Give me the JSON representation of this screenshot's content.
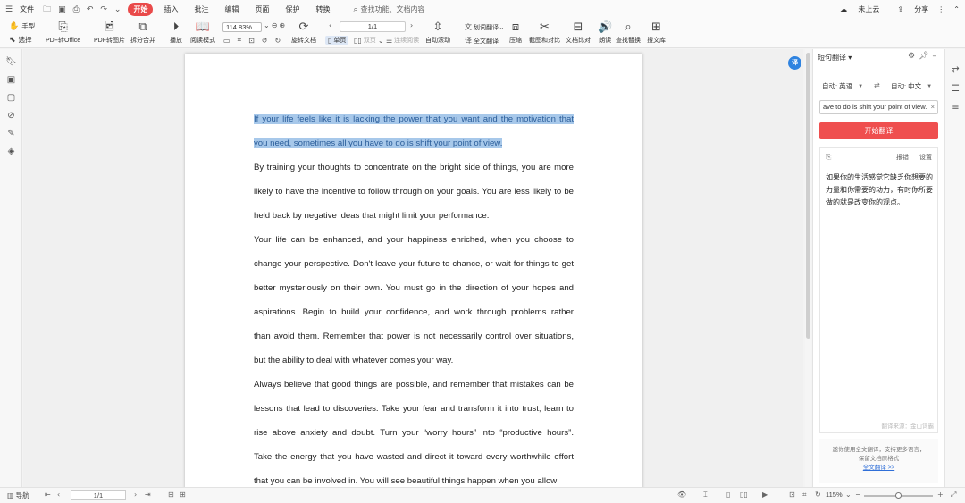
{
  "menubar": {
    "file": "文件",
    "tabs": [
      "开始",
      "插入",
      "批注",
      "编辑",
      "页面",
      "保护",
      "转换"
    ],
    "active_tab": "开始",
    "search": "查找功能、文档内容",
    "cloud": "未上云",
    "share": "分享"
  },
  "toolbar": {
    "hand": "手型",
    "select": "选择",
    "pdf_to_office": "PDF转Office",
    "pdf_to_image": "PDF转图片",
    "split_merge": "拆分合并",
    "play": "播放",
    "read_mode": "阅读模式",
    "zoom": "114.83%",
    "rotate_doc": "旋转文档",
    "single_page": "单页",
    "double_page": "双页",
    "continuous": "连续阅读",
    "page_indicator": "1/1",
    "auto_scroll": "自动滚动",
    "word_translate": "划词翻译",
    "full_translate": "全文翻译",
    "compress": "压缩",
    "screenshot_compare": "截图和对比",
    "doc_compare": "文档比对",
    "read_aloud": "朗读",
    "find_replace": "查找替换",
    "search_lib": "搜文库"
  },
  "document": {
    "paragraphs": [
      {
        "highlighted": true,
        "lines": [
          "If your life feels like it is lacking the power that you want and the motivation that",
          "you need, sometimes all you have to do is shift your point of view."
        ]
      },
      {
        "highlighted": false,
        "lines": [
          "By training your thoughts to concentrate on the bright side of things, you are more",
          "likely to have the incentive to follow through on your goals. You are less likely to be",
          "held back by negative ideas that might limit your performance."
        ]
      },
      {
        "highlighted": false,
        "lines": [
          "Your life can be enhanced, and your happiness enriched, when you choose to",
          "change your perspective. Don't leave your future to chance, or wait for things to get",
          "better mysteriously on their own. You must go in the direction of your hopes and",
          "aspirations. Begin to build your confidence, and work through problems rather",
          "than avoid them. Remember that power is not necessarily control over situations,",
          "but the ability to deal with whatever comes your way."
        ]
      },
      {
        "highlighted": false,
        "lines": [
          "Always believe that good things are possible, and remember that mistakes can be",
          "lessons that lead to discoveries. Take your fear and transform it into trust; learn to",
          "rise above anxiety and doubt. Turn your “worry hours” into “productive hours”.",
          "Take the energy that you have wasted and direct it toward every worthwhile effort",
          "that you can be involved in. You will see beautiful things happen when you allow"
        ]
      }
    ]
  },
  "translate_panel": {
    "title": "短句翻译",
    "source_lang": "自动: 英语",
    "target_lang": "自动: 中文",
    "source_text": "ave to do is shift your point of view.",
    "translate_button": "开始翻译",
    "report": "报错",
    "settings": "设置",
    "result": "如果你的生活感觉它缺乏你想要的力量和你需要的动力，有时你所要做的就是改变你的观点。",
    "source_note": "翻译来源：金山词霸",
    "promo_text": "邀你使用全文翻译，支持更多语言，保留文档原格式",
    "promo_link": "全文翻译 >>"
  },
  "statusbar": {
    "nav": "导航",
    "page": "1/1",
    "zoom": "115%",
    "zoom_level": 0.5
  },
  "colors": {
    "accent_red": "#ef4f4f",
    "highlight": "#a7c8ea",
    "avatar_blue": "#2f83e0"
  }
}
